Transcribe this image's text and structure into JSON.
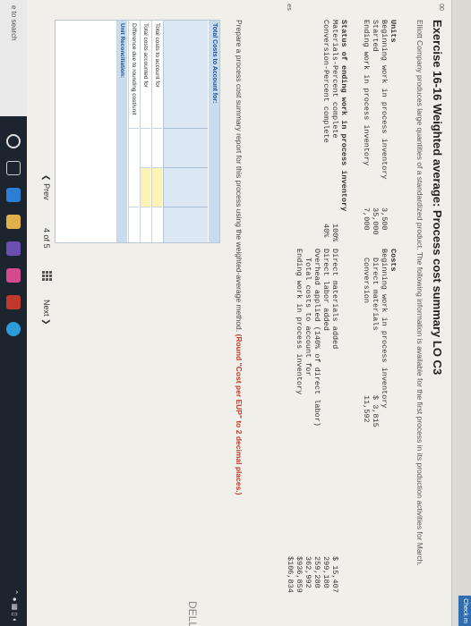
{
  "header": {
    "check_label": "Check m",
    "side_badges": [
      "00",
      "es"
    ]
  },
  "exercise": {
    "title": "Exercise 16-16 Weighted average: Process cost summary LO C3",
    "intro": "Elliott Company produces large quantities of a standardized product. The following information is available for the first process in its production activities for March."
  },
  "data_block": {
    "units_heading": "Units",
    "units_rows": [
      {
        "label": "Beginning work in process inventory",
        "value": "3,500"
      },
      {
        "label": "Started",
        "value": "35,000"
      },
      {
        "label": "Ending work in process inventory",
        "value": "7,000"
      }
    ],
    "status_heading": "Status of ending work in process inventory",
    "status_rows": [
      {
        "label": "Materials-Percent complete",
        "value": "100%"
      },
      {
        "label": "Conversion-Percent complete",
        "value": "40%"
      }
    ],
    "costs_heading": "Costs",
    "costs_rows": [
      {
        "label": "Beginning work in process inventory",
        "value": ""
      },
      {
        "label": "Direct materials",
        "value": "$ 3,815"
      },
      {
        "label": "Conversion",
        "value": "11,592"
      },
      {
        "label": "Direct materials added",
        "value": "$ 15,407"
      },
      {
        "label": "Direct labor added",
        "value": "299,180"
      },
      {
        "label": "Overhead applied (140% of direct labor)",
        "value": "259,280"
      },
      {
        "label": "Total costs to account for",
        "value": "362,992"
      },
      {
        "label": "Ending work in process inventory",
        "value": "$936,859"
      },
      {
        "label": "",
        "value": "$106,834"
      }
    ]
  },
  "prompt": {
    "text": "Prepare a process cost summary report for this process using the weighted-average method.",
    "emph": "(Round \"Cost per EUP\" to 2 decimal places.)"
  },
  "table": {
    "header": "Total Costs to Account for:",
    "rows": [
      "Total costs to account for",
      "Total costs accounted for",
      "Difference due to rounding cost/unit",
      "Unit Reconciliation:"
    ]
  },
  "nav": {
    "prev": "Prev",
    "page_current": "4",
    "page_of": "of",
    "page_total": "5",
    "next": "Next"
  },
  "taskbar": {
    "search": "e to search"
  },
  "bezel": {
    "brand": "DELL"
  }
}
